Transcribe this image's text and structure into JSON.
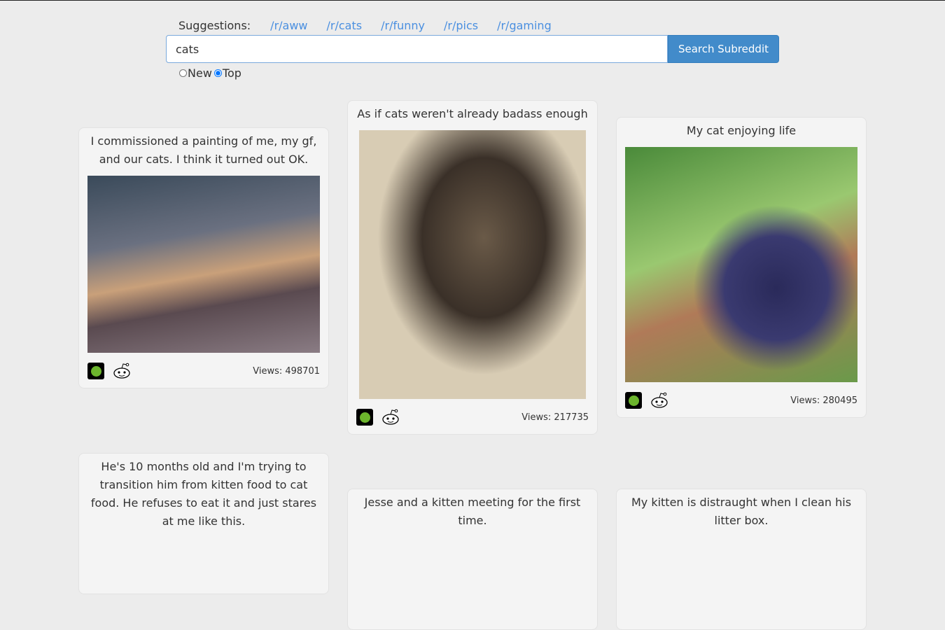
{
  "suggestions": {
    "label": "Suggestions:",
    "links": [
      "/r/aww",
      "/r/cats",
      "/r/funny",
      "/r/pics",
      "/r/gaming"
    ]
  },
  "search": {
    "value": "cats",
    "button": "Search Subreddit"
  },
  "sort": {
    "options": [
      "New",
      "Top"
    ],
    "selected": "Top"
  },
  "posts": [
    {
      "title": "I commissioned a painting of me, my gf, and our cats. I think it turned out OK.",
      "views": "Views: 498701"
    },
    {
      "title": "As if cats weren't already badass enough",
      "views": "Views: 217735"
    },
    {
      "title": "My cat enjoying life",
      "views": "Views: 280495"
    },
    {
      "title": "He's 10 months old and I'm trying to transition him from kitten food to cat food. He refuses to eat it and just stares at me like this."
    },
    {
      "title": "Jesse and a kitten meeting for the first time."
    },
    {
      "title": "My kitten is distraught when I clean his litter box."
    }
  ]
}
